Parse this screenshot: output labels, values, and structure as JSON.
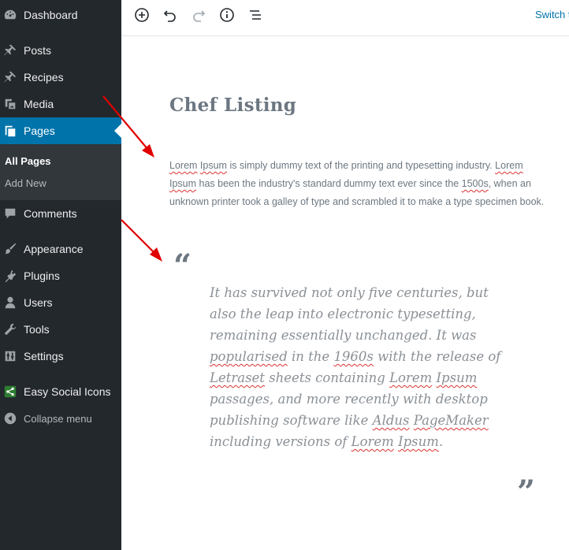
{
  "sidebar": {
    "items": [
      {
        "label": "Dashboard",
        "icon": "dashboard-icon"
      },
      {
        "label": "Posts",
        "icon": "pin-icon"
      },
      {
        "label": "Recipes",
        "icon": "pin-icon"
      },
      {
        "label": "Media",
        "icon": "media-icon"
      },
      {
        "label": "Pages",
        "icon": "pages-icon",
        "current": true
      },
      {
        "label": "Comments",
        "icon": "comment-icon"
      },
      {
        "label": "Appearance",
        "icon": "brush-icon"
      },
      {
        "label": "Plugins",
        "icon": "plugin-icon"
      },
      {
        "label": "Users",
        "icon": "user-icon"
      },
      {
        "label": "Tools",
        "icon": "wrench-icon"
      },
      {
        "label": "Settings",
        "icon": "settings-icon"
      },
      {
        "label": "Easy Social Icons",
        "icon": "share-icon"
      }
    ],
    "submenu": [
      {
        "label": "All Pages",
        "active": true
      },
      {
        "label": "Add New"
      }
    ],
    "collapse_label": "Collapse menu",
    "accent_color": "#0073aa"
  },
  "toolbar": {
    "buttons": [
      "add-block-icon",
      "undo-icon",
      "redo-icon",
      "info-icon",
      "list-view-icon"
    ],
    "switch_label": "Switch t"
  },
  "post": {
    "title": "Chef Listing",
    "paragraph": {
      "w1": "Lorem",
      "w2": "Ipsum",
      "t1": " is simply dummy text of the printing and typesetting industry. ",
      "w3": "Lorem",
      "w4": "Ipsum",
      "t2": " has been the industry's standard dummy text ever since the ",
      "w5": "1500s",
      "t3": ", when an unknown printer took a galley of type and scrambled it to make a type specimen book."
    },
    "quote": {
      "open_mark": "“",
      "close_mark": "”",
      "t1": " It has survived not only five centuries, but also the leap into electronic typesetting, remaining essentially unchanged. It was ",
      "w1": "popularised",
      "t2": " in the ",
      "w2": "1960s",
      "t3": " with the release of ",
      "w3": "Letraset",
      "t4": " sheets containing ",
      "w4": "Lorem",
      "t5": " ",
      "w5": "Ipsum",
      "t6": " passages, and more recently with desktop publishing software like ",
      "w6": "Aldus",
      "t7": " ",
      "w7": "PageMaker",
      "t8": " including versions of ",
      "w8": "Lorem",
      "t9": " ",
      "w9": "Ipsum",
      "t10": "."
    }
  },
  "annotation_color": "#e00000"
}
